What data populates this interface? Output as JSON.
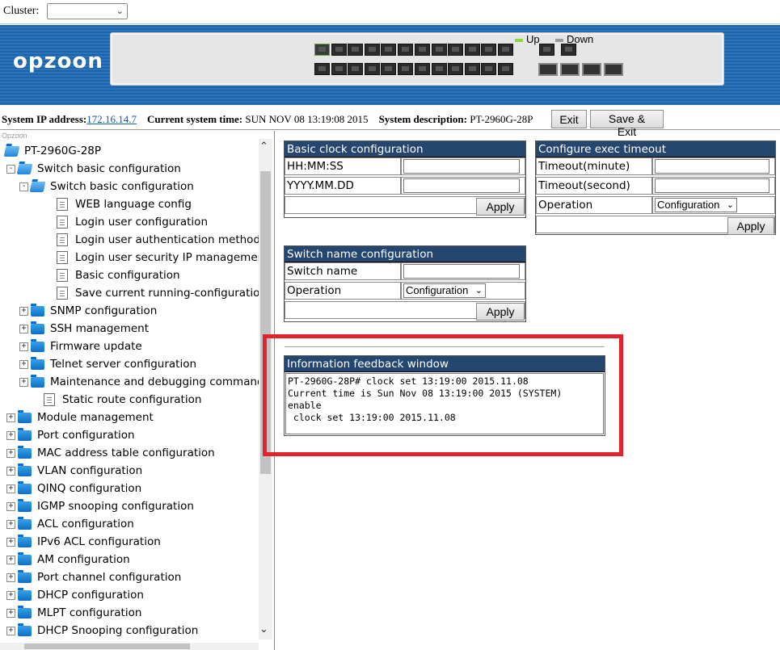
{
  "cluster": {
    "label": "Cluster:",
    "value": ""
  },
  "banner": {
    "logo": "opzoon",
    "legend_up": "Up",
    "legend_down": "Down",
    "colors": {
      "up": "#8fd63a",
      "down": "#9a9a9a"
    }
  },
  "info": {
    "ip_label": "System IP address:",
    "ip_value": "172.16.14.7",
    "time_label": "Current system time:",
    "time_value": "SUN NOV 08 13:19:08 2015",
    "desc_label": "System description:",
    "desc_value": "PT-2960G-28P",
    "exit_label": "Exit",
    "save_exit_label": "Save & Exit"
  },
  "tree": {
    "mini_label": "Opzoon",
    "root": "PT-2960G-28P",
    "items": [
      "Switch basic configuration",
      "Switch basic configuration",
      "WEB language config",
      "Login user configuration",
      "Login user authentication method c",
      "Login user security IP management",
      "Basic configuration",
      "Save current running-configuration",
      "SNMP configuration",
      "SSH management",
      "Firmware update",
      "Telnet server configuration",
      "Maintenance and debugging command",
      "Static route configuration",
      "Module management",
      "Port configuration",
      "MAC address table configuration",
      "VLAN configuration",
      "QINQ configuration",
      "IGMP snooping configuration",
      "ACL configuration",
      "IPv6 ACL configuration",
      "AM configuration",
      "Port channel configuration",
      "DHCP configuration",
      "MLPT configuration",
      "DHCP Snooping configuration"
    ]
  },
  "clock": {
    "title": "Basic clock configuration",
    "time_label": "HH:MM:SS",
    "date_label": "YYYY.MM.DD",
    "apply": "Apply"
  },
  "exec_timeout": {
    "title": "Configure exec timeout",
    "minute_label": "Timeout(minute)",
    "second_label": "Timeout(second)",
    "operation_label": "Operation",
    "operation_value": "Configuration",
    "apply": "Apply"
  },
  "switch_name": {
    "title": "Switch name configuration",
    "name_label": "Switch name",
    "operation_label": "Operation",
    "operation_value": "Configuration",
    "apply": "Apply"
  },
  "feedback": {
    "title": "Information feedback window",
    "text": "PT-2960G-28P# clock set 13:19:00 2015.11.08\nCurrent time is Sun Nov 08 13:19:00 2015 (SYSTEM)\nenable\n clock set 13:19:00 2015.11.08",
    "highlight_color": "#e4222b"
  }
}
